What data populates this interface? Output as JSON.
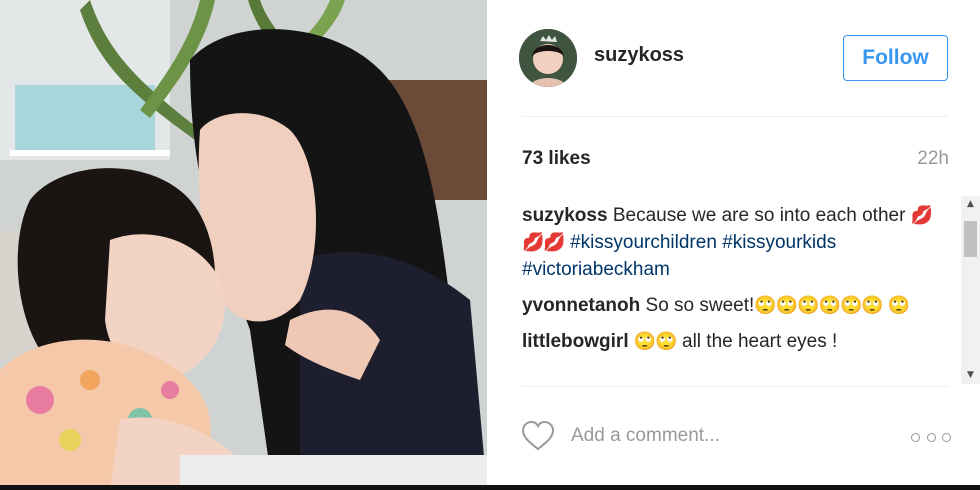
{
  "post": {
    "username": "suzykoss",
    "follow_label": "Follow",
    "likes": "73 likes",
    "time_ago": "22h"
  },
  "caption": {
    "user": "suzykoss",
    "text": "Because we are so into each other",
    "emoji": "💋💋💋",
    "hashtags": [
      "#kissyourchildren",
      "#kissyourkids",
      "#victoriabeckham"
    ]
  },
  "comments": [
    {
      "user": "yvonnetanoh",
      "text": "So so sweet!",
      "emoji": "🙄🙄🙄🙄🙄🙄 🙄"
    },
    {
      "user": "littlebowgirl",
      "emoji": "🙄🙄",
      "text": "all the heart eyes !"
    }
  ],
  "comment_box": {
    "placeholder": "Add a comment..."
  },
  "icons": {
    "like": "heart-icon",
    "more": "more-options-icon",
    "scroll_up": "scroll-up-arrow-icon",
    "scroll_down": "scroll-down-arrow-icon"
  },
  "colors": {
    "follow_blue": "#3897f0",
    "hashtag": "#003569",
    "muted": "#999999"
  }
}
